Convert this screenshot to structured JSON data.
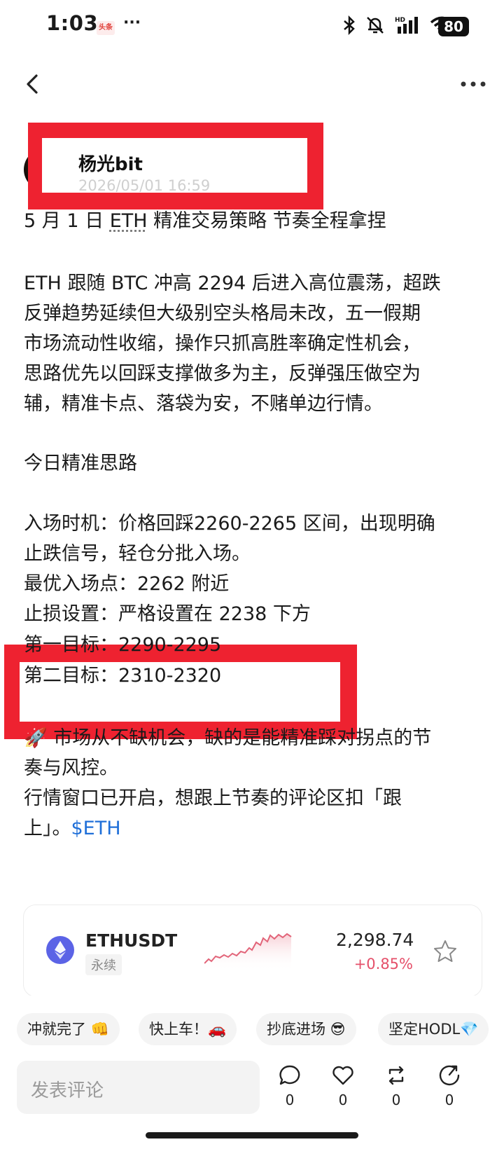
{
  "status_bar": {
    "time": "1:03",
    "news_badge": "头条",
    "dots": "···",
    "battery": "80"
  },
  "author": {
    "name": "杨光bit",
    "time": "2026/05/01 16:59"
  },
  "post": {
    "title_pre": "5 月 1 日 ",
    "title_ticker": "ETH",
    "title_post": " 精准交易策略 节奏全程拿捏",
    "para1": [
      "ETH 跟随 BTC 冲高 2294 后进入高位震荡，超跌",
      "反弹趋势延续但大级别空头格局未改，五一假期",
      "市场流动性收缩，操作只抓高胜率确定性机会，",
      "思路优先以回踩支撑做多为主，反弹强压做空为",
      "辅，精准卡点、落袋为安，不赌单边行情。"
    ],
    "section": "今日精准思路",
    "entry": [
      "入场时机：价格回踩2260-2265 区间，出现明确",
      "止跌信号，轻仓分批入场。"
    ],
    "best_entry": "最优入场点：2262 附近",
    "stop_loss": "止损设置：严格设置在 2238 下方",
    "target1": "第一目标：2290-2295",
    "target2": "第二目标：2310-2320",
    "closing1": "市场从不缺机会，缺的是能精准踩对拐点的节",
    "closing2": "奏与风控。",
    "closing3": "行情窗口已开启，想跟上节奏的评论区扣「跟",
    "closing4": "上」。",
    "tag": "$ETH"
  },
  "ticker_card": {
    "symbol": "ETHUSDT",
    "type": "永续",
    "price": "2,298.74",
    "change": "+0.85%"
  },
  "quick_replies": [
    "冲就完了 👊",
    "快上车！🚗",
    "抄底进场 😎",
    "坚定HODL💎"
  ],
  "comment": {
    "placeholder": "发表评论"
  },
  "actions": {
    "comments": "0",
    "likes": "0",
    "reposts": "0",
    "shares": "0"
  },
  "colors": {
    "highlight_red": "#ee2230",
    "link_blue": "#1f6fd8",
    "change_red": "#e5506a"
  }
}
